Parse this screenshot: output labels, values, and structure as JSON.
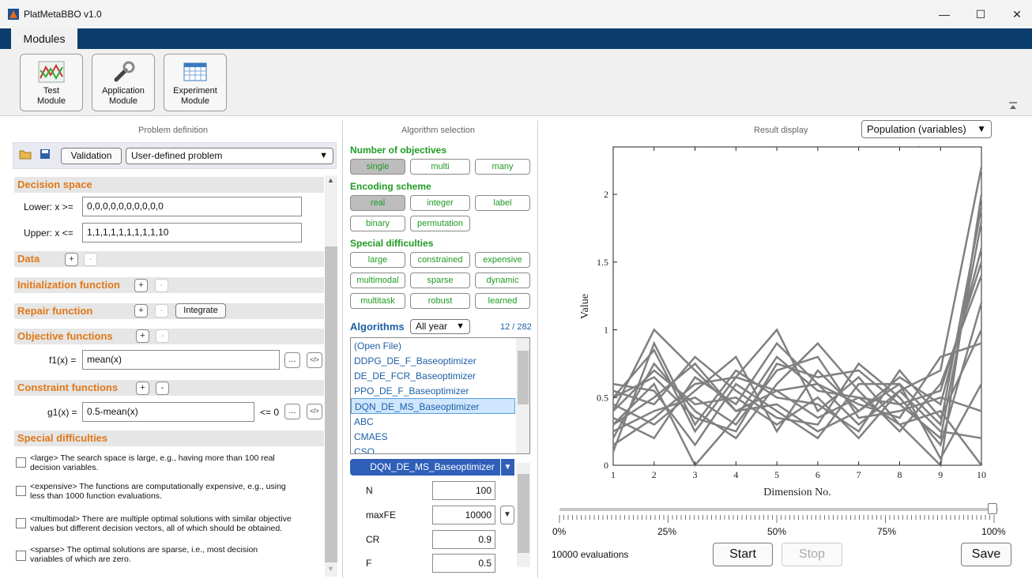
{
  "window": {
    "title": "PlatMetaBBO v1.0",
    "min": "—",
    "max": "☐",
    "close": "✕"
  },
  "ribbon": {
    "tab": "Modules",
    "modules": [
      {
        "line1": "Test",
        "line2": "Module"
      },
      {
        "line1": "Application",
        "line2": "Module"
      },
      {
        "line1": "Experiment",
        "line2": "Module"
      }
    ]
  },
  "problem": {
    "title": "Problem definition",
    "validation": "Validation",
    "problem_select": "User-defined problem",
    "decision_space": "Decision space",
    "lower_label": "Lower: x >=",
    "lower_value": "0,0,0,0,0,0,0,0,0,0",
    "upper_label": "Upper: x <=",
    "upper_value": "1,1,1,1,1,1,1,1,1,10",
    "data": "Data",
    "init_fn": "Initialization function",
    "repair_fn": "Repair function",
    "integrate": "Integrate",
    "objective_fns": "Objective functions",
    "f1_label": "f1(x) =",
    "f1_value": "mean(x)",
    "constraint_fns": "Constraint functions",
    "g1_label": "g1(x) =",
    "g1_value": "0.5-mean(x)",
    "g1_rel": "<= 0",
    "ellipsis": "...",
    "code": "</>",
    "plus": "+",
    "minus": "-",
    "special": "Special difficulties",
    "difficulties": [
      {
        "l1": "<large> The search space is large, e.g., having more than 100 real",
        "l2": "decision variables."
      },
      {
        "l1": "<expensive> The functions are computationally expensive, e.g., using",
        "l2": "less than 1000 function evaluations."
      },
      {
        "l1": "<multimodal> There are multiple optimal solutions with similar objective",
        "l2": "values but different decision vectors, all of which should be obtained."
      },
      {
        "l1": "<sparse> The optimal solutions are sparse, i.e., most decision",
        "l2": "variables of which are zero."
      }
    ]
  },
  "algorithm": {
    "title": "Algorithm selection",
    "num_obj": "Number of objectives",
    "obj": [
      "single",
      "multi",
      "many"
    ],
    "encoding": "Encoding scheme",
    "enc": [
      "real",
      "integer",
      "label",
      "binary",
      "permutation"
    ],
    "special": "Special difficulties",
    "spec": [
      "large",
      "constrained",
      "expensive",
      "multimodal",
      "sparse",
      "dynamic",
      "multitask",
      "robust",
      "learned"
    ],
    "algorithms_label": "Algorithms",
    "year_select": "All year",
    "count": "12 / 282",
    "list": [
      "(Open File)",
      "DDPG_DE_F_Baseoptimizer",
      "DE_DE_FCR_Baseoptimizer",
      "PPO_DE_F_Baseoptimizer",
      "DQN_DE_MS_Baseoptimizer",
      "ABC",
      "CMAES",
      "CSO"
    ],
    "selected": "DQN_DE_MS_Baseoptimizer",
    "params": [
      {
        "name": "N",
        "value": "100"
      },
      {
        "name": "maxFE",
        "value": "10000"
      },
      {
        "name": "CR",
        "value": "0.9"
      },
      {
        "name": "F",
        "value": "0.5"
      }
    ]
  },
  "result": {
    "title": "Result display",
    "display_select": "Population (variables)",
    "evaluations": "10000 evaluations",
    "start": "Start",
    "stop": "Stop",
    "save": "Save",
    "slider_labels": [
      "0%",
      "25%",
      "50%",
      "75%",
      "100%"
    ],
    "slider_position": 1.0
  },
  "chart_data": {
    "type": "line",
    "xlabel": "Dimension No.",
    "ylabel": "Value",
    "x": [
      1,
      2,
      3,
      4,
      5,
      6,
      7,
      8,
      9,
      10
    ],
    "xlim": [
      1,
      10
    ],
    "ylim": [
      0,
      2.35
    ],
    "yticks": [
      0,
      0.5,
      1,
      1.5,
      2
    ],
    "color": "#808080",
    "series": [
      {
        "values": [
          0.4,
          1.0,
          0.7,
          0.4,
          0.55,
          0.6,
          0.3,
          0.55,
          0.7,
          2.2
        ]
      },
      {
        "values": [
          0.5,
          0.85,
          0.25,
          0.65,
          1.0,
          0.4,
          0.65,
          0.3,
          0.0,
          2.0
        ]
      },
      {
        "values": [
          0.3,
          0.6,
          0.0,
          0.35,
          0.8,
          0.55,
          0.5,
          0.45,
          0.2,
          1.8
        ]
      },
      {
        "values": [
          0.45,
          0.3,
          0.55,
          0.8,
          0.25,
          0.7,
          0.4,
          0.65,
          0.45,
          1.6
        ]
      },
      {
        "values": [
          0.2,
          0.75,
          0.4,
          0.2,
          0.6,
          0.9,
          0.55,
          0.25,
          0.6,
          1.4
        ]
      },
      {
        "values": [
          0.55,
          0.45,
          0.8,
          0.55,
          0.35,
          0.3,
          0.75,
          0.5,
          0.15,
          1.2
        ]
      },
      {
        "values": [
          0.1,
          0.9,
          0.3,
          0.7,
          0.5,
          0.45,
          0.25,
          0.7,
          0.35,
          1.0
        ]
      },
      {
        "values": [
          0.35,
          0.2,
          0.65,
          0.45,
          0.9,
          0.6,
          0.45,
          0.35,
          0.8,
          0.9
        ]
      },
      {
        "values": [
          0.6,
          0.55,
          0.15,
          0.6,
          0.4,
          0.2,
          0.6,
          0.6,
          0.05,
          0.6
        ]
      },
      {
        "values": [
          0.25,
          0.4,
          0.5,
          0.3,
          0.7,
          0.8,
          0.35,
          0.4,
          0.5,
          0.4
        ]
      },
      {
        "values": [
          0.4,
          0.7,
          0.45,
          0.5,
          0.3,
          0.5,
          0.2,
          0.55,
          0.25,
          0.2
        ]
      },
      {
        "values": [
          0.15,
          0.35,
          0.6,
          0.65,
          0.55,
          0.35,
          0.5,
          0.3,
          0.4,
          0.0
        ]
      },
      {
        "values": [
          0.5,
          0.65,
          0.35,
          0.25,
          0.75,
          0.65,
          0.7,
          0.45,
          0.55,
          1.5
        ]
      },
      {
        "values": [
          0.3,
          0.5,
          0.75,
          0.4,
          0.45,
          0.25,
          0.4,
          0.6,
          0.3,
          1.9
        ]
      }
    ]
  }
}
